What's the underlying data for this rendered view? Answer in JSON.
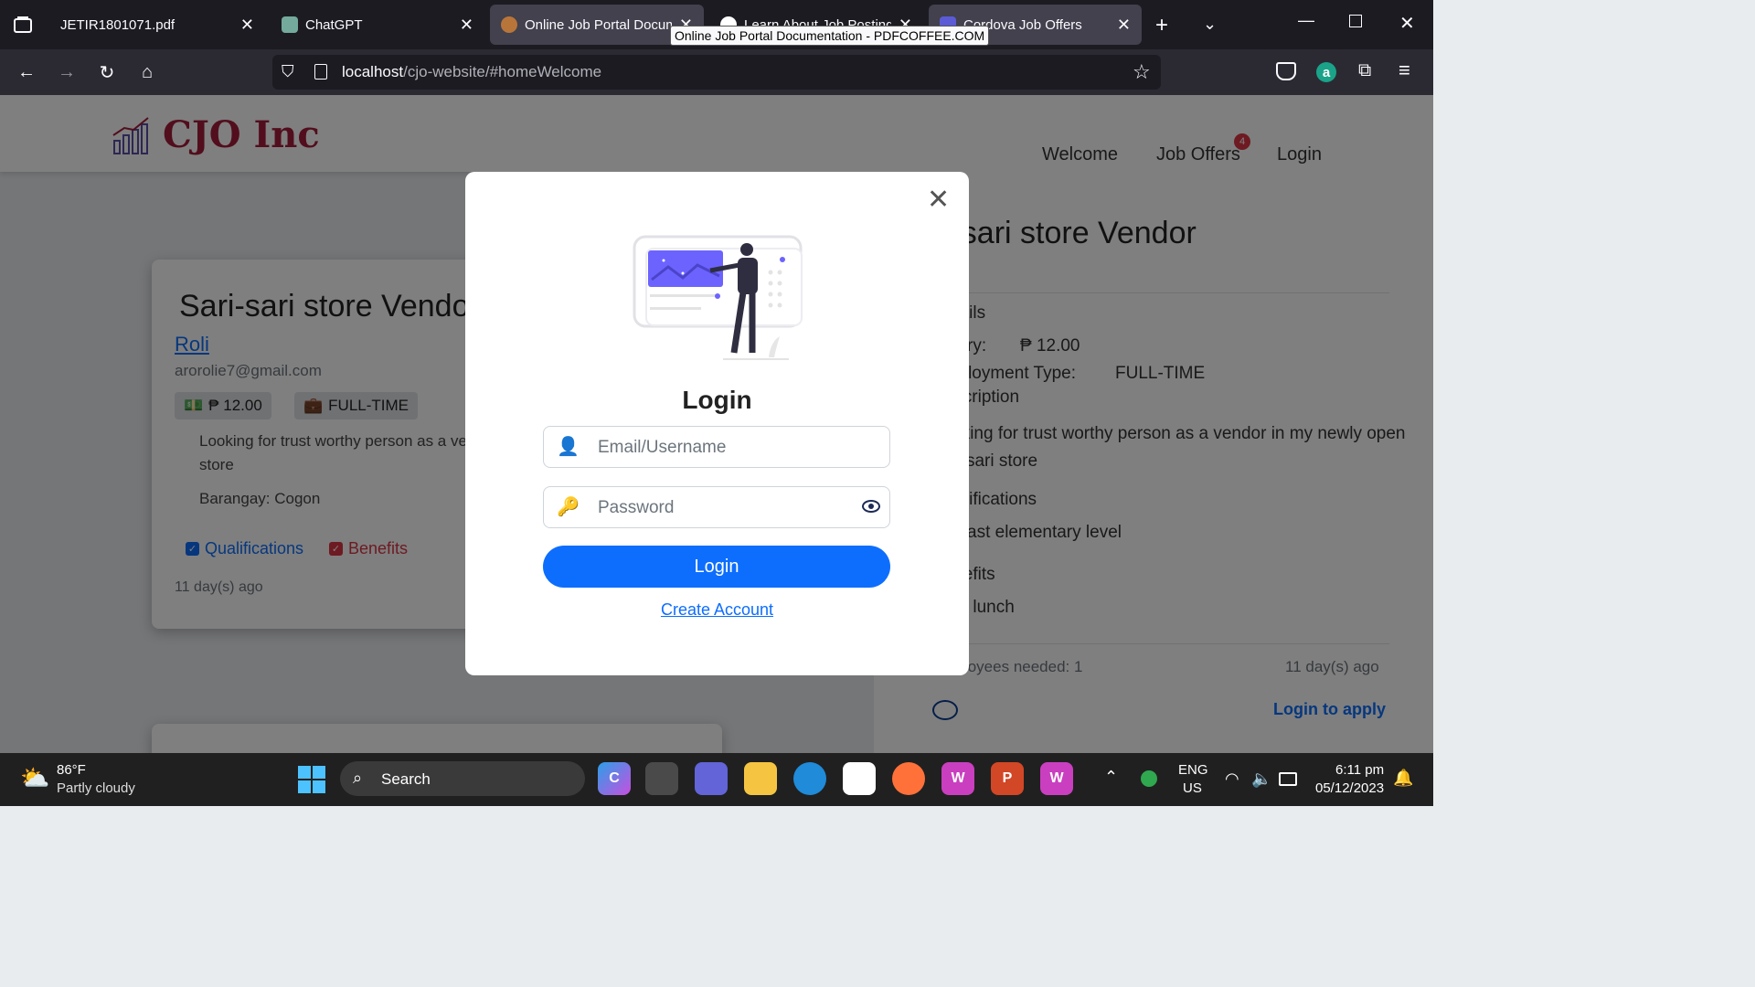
{
  "browser": {
    "tabs": [
      {
        "title": "JETIR1801071.pdf",
        "active": false
      },
      {
        "title": "ChatGPT",
        "active": false
      },
      {
        "title": "Online Job Portal Docum",
        "active": true
      },
      {
        "title": "Learn About Job Posting",
        "active": false
      },
      {
        "title": "Cordova Job Offers",
        "active": false
      }
    ],
    "tooltip": "Online Job Portal Documentation - PDFCOFFEE.COM",
    "url_host": "localhost",
    "url_path": "/cjo-website/#homeWelcome"
  },
  "site": {
    "brand": "CJO Inc",
    "nav": {
      "welcome": "Welcome",
      "job_offers": "Job Offers",
      "login": "Login",
      "job_offers_badge": "4"
    }
  },
  "job_card": {
    "title": "Sari-sari store Vendor",
    "poster_name": "Roli",
    "poster_email": "arorolie7@gmail.com",
    "salary": "₱ 12.00",
    "type": "FULL-TIME",
    "description": "Looking for trust worthy person as a vendor in my newly open sari-sari store",
    "barangay": "Barangay: Cogon",
    "qualifications_label": "Qualifications",
    "benefits_label": "Benefits",
    "posted": "11 day(s) ago"
  },
  "detail_panel": {
    "title": "Sari-sari store Vendor",
    "details_heading": "Details",
    "salary_label": "Salary:",
    "salary_value": "₱ 12.00",
    "employment_label": "Employment Type:",
    "employment_value": "FULL-TIME",
    "description_heading": "Description",
    "description": "Looking for trust worthy person as a vendor in my newly open sari-sari store",
    "qualifications_heading": "Qualifications",
    "qualification_item": "At least elementary level",
    "benefits_heading": "Benefits",
    "benefit_item": "Free lunch",
    "employees_needed": "Employees needed: 1",
    "posted": "11 day(s) ago",
    "apply_link": "Login to apply"
  },
  "modal": {
    "title": "Login",
    "email_placeholder": "Email/Username",
    "password_placeholder": "Password",
    "login_button": "Login",
    "create_account": "Create Account"
  },
  "taskbar": {
    "weather_temp": "86°F",
    "weather_desc": "Partly cloudy",
    "search": "Search",
    "lang_1": "ENG",
    "lang_2": "US",
    "time": "6:11 pm",
    "date": "05/12/2023"
  },
  "colors": {
    "brand": "#a51c3a",
    "primary": "#0d6efd",
    "danger": "#dc3545"
  }
}
